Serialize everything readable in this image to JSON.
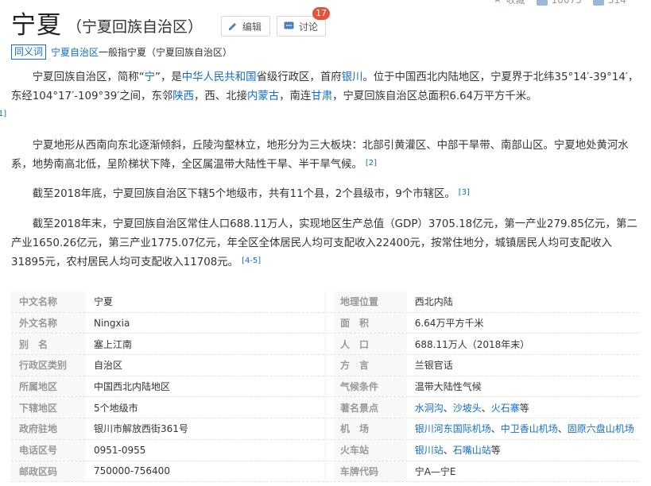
{
  "top_stats": {
    "collect_label": "收藏",
    "count1": "10075",
    "count2": "314"
  },
  "title": {
    "main": "宁夏",
    "sub": "（宁夏回族自治区）"
  },
  "actions": {
    "edit_label": "编辑",
    "discuss_label": "讨论",
    "discuss_badge": "17"
  },
  "polysemy": {
    "tag": "同义词",
    "link": "宁夏自治区",
    "text": "一般指宁夏（宁夏回族自治区）"
  },
  "paragraphs": {
    "p1": {
      "t1": "宁夏回族自治区，简称“",
      "l1": "宁",
      "t2": "”，是",
      "l2": "中华人民共和国",
      "t3": "省级行政区，首府",
      "l3": "银川",
      "t4": "。位于中国西北内陆地区，宁夏界于北纬35°14′-39°14′，东经104°17′-109°39′之间，东邻",
      "l4": "陕西",
      "t5": "，西、北接",
      "l5": "内蒙古",
      "t6": "，南连",
      "l6": "甘肃",
      "t7": "，宁夏回族自治区总面积6.64万平方千米。",
      "ref": "[1]"
    },
    "p2": {
      "text": "宁夏地形从西南向东北逐渐倾斜，丘陵沟壑林立，地形分为三大板块：北部引黄灌区、中部干旱带、南部山区。宁夏地处黄河水系，地势南高北低，呈阶梯状下降，全区属温带大陆性干旱、半干旱气候。",
      "ref": "[2]"
    },
    "p3": {
      "text": "截至2018年底，宁夏回族自治区下辖5个地级市，共有11个县，2个县级市，9个市辖区。",
      "ref": "[3]"
    },
    "p4": {
      "text": "截至2018年末，宁夏回族自治区常住人口688.11万人，实现地区生产总值（GDP）3705.18亿元，第一产业279.85亿元，第二产业1650.26亿元，第三产业1775.07亿元，年全区全体居民人均可支配收入22400元，按常住地分，城镇居民人均可支配收入31895元，农村居民人均可支配收入11708元。",
      "ref": "[4-5]"
    }
  },
  "info": {
    "r0": {
      "l": "中文名称",
      "v": "宁夏",
      "l2": "地理位置",
      "v2": "西北内陆"
    },
    "r1": {
      "l": "外文名称",
      "v": "Ningxia",
      "l2": "面　积",
      "v2": "6.64万平方千米"
    },
    "r2": {
      "l": "别　名",
      "v": "塞上江南",
      "l2": "人　口",
      "v2": "688.11万人（2018年末）"
    },
    "r3": {
      "l": "行政区类别",
      "v": "自治区",
      "l2": "方　言",
      "v2": "兰银官话"
    },
    "r4": {
      "l": "所属地区",
      "v": "中国西北内陆地区",
      "l2": "气候条件",
      "v2": "温带大陆性气候"
    },
    "r5": {
      "l": "下辖地区",
      "v": "5个地级市",
      "l2": "著名景点",
      "links": [
        "水洞沟",
        "沙坡头",
        "火石寨"
      ],
      "seps": [
        "、",
        "、"
      ],
      "suffix": "等"
    },
    "r6": {
      "l": "政府驻地",
      "v": "银川市解放西街361号",
      "l2": "机　场",
      "links": [
        "银川河东国际机场",
        "中卫香山机场",
        "固原六盘山机场"
      ],
      "seps": [
        "、",
        "、"
      ]
    },
    "r7": {
      "l": "电话区号",
      "v": "0951-0955",
      "l2": "火车站",
      "links": [
        "银川站",
        "石嘴山站"
      ],
      "seps": [
        "、"
      ],
      "suffix": "等"
    },
    "r8": {
      "l": "邮政区码",
      "v": "750000-756400",
      "l2": "车牌代码",
      "v2": "宁A—宁E"
    }
  }
}
